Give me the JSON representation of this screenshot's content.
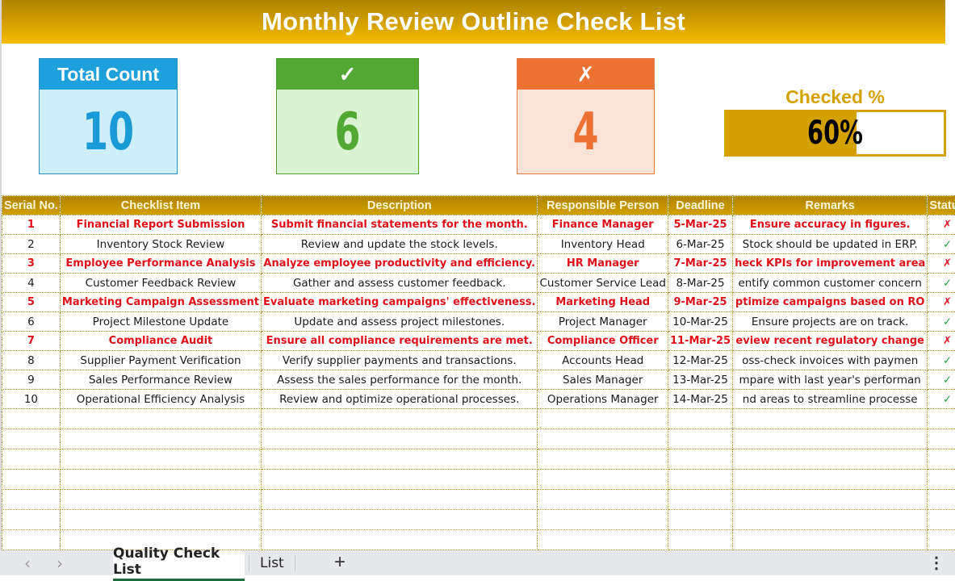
{
  "title": "Monthly Review Outline Check List",
  "cards": {
    "total": {
      "label": "Total Count",
      "value": "10"
    },
    "checked": {
      "label": "✓",
      "value": "6"
    },
    "unchecked": {
      "label": "✗",
      "value": "4"
    }
  },
  "checked_percent": {
    "label": "Checked %",
    "value": "60%",
    "fraction": 0.6
  },
  "colors": {
    "accent": "#d4a100",
    "check": "#1fa24a",
    "cross": "#e0101a",
    "total": "#1ea0dc",
    "checked_card": "#52a832",
    "unchecked_card": "#ec7234"
  },
  "table": {
    "headers": [
      "Serial No.",
      "Checklist Item",
      "Description",
      "Responsible Person",
      "Deadline",
      "Remarks",
      "Status"
    ],
    "rows": [
      {
        "serial": "1",
        "item": "Financial Report Submission",
        "description": "Submit financial statements for the month.",
        "person": "Finance Manager",
        "deadline": "5-Mar-25",
        "remarks": "Ensure accuracy in figures.",
        "status": "✗",
        "highlight": true
      },
      {
        "serial": "2",
        "item": "Inventory Stock Review",
        "description": "Review and update the stock levels.",
        "person": "Inventory Head",
        "deadline": "6-Mar-25",
        "remarks": "Stock should be updated in ERP.",
        "status": "✓",
        "highlight": false
      },
      {
        "serial": "3",
        "item": "Employee Performance Analysis",
        "description": "Analyze employee productivity and efficiency.",
        "person": "HR Manager",
        "deadline": "7-Mar-25",
        "remarks": "heck KPIs for improvement area",
        "status": "✗",
        "highlight": true
      },
      {
        "serial": "4",
        "item": "Customer Feedback Review",
        "description": "Gather and assess customer feedback.",
        "person": "Customer Service Lead",
        "deadline": "8-Mar-25",
        "remarks": "entify common customer concern",
        "status": "✓",
        "highlight": false
      },
      {
        "serial": "5",
        "item": "Marketing Campaign Assessment",
        "description": "Evaluate marketing campaigns' effectiveness.",
        "person": "Marketing Head",
        "deadline": "9-Mar-25",
        "remarks": "ptimize campaigns based on RO",
        "status": "✗",
        "highlight": true
      },
      {
        "serial": "6",
        "item": "Project Milestone Update",
        "description": "Update and assess project milestones.",
        "person": "Project Manager",
        "deadline": "10-Mar-25",
        "remarks": "Ensure projects are on track.",
        "status": "✓",
        "highlight": false
      },
      {
        "serial": "7",
        "item": "Compliance Audit",
        "description": "Ensure all compliance requirements are met.",
        "person": "Compliance Officer",
        "deadline": "11-Mar-25",
        "remarks": "eview recent regulatory change",
        "status": "✗",
        "highlight": true
      },
      {
        "serial": "8",
        "item": "Supplier Payment Verification",
        "description": "Verify supplier payments and transactions.",
        "person": "Accounts Head",
        "deadline": "12-Mar-25",
        "remarks": "oss-check invoices with paymen",
        "status": "✓",
        "highlight": false
      },
      {
        "serial": "9",
        "item": "Sales Performance Review",
        "description": "Assess the sales performance for the month.",
        "person": "Sales Manager",
        "deadline": "13-Mar-25",
        "remarks": "mpare with last year's performan",
        "status": "✓",
        "highlight": false
      },
      {
        "serial": "10",
        "item": "Operational Efficiency Analysis",
        "description": "Review and optimize operational processes.",
        "person": "Operations Manager",
        "deadline": "14-Mar-25",
        "remarks": "nd areas to streamline processe",
        "status": "✓",
        "highlight": false
      }
    ]
  },
  "sheet_tabs": {
    "prev_icon": "chevron-left-icon",
    "next_icon": "chevron-right-icon",
    "tabs": [
      {
        "label": "Quality Check List",
        "active": true
      },
      {
        "label": "List",
        "active": false
      }
    ],
    "add_label": "+",
    "more_label": "⋮"
  }
}
